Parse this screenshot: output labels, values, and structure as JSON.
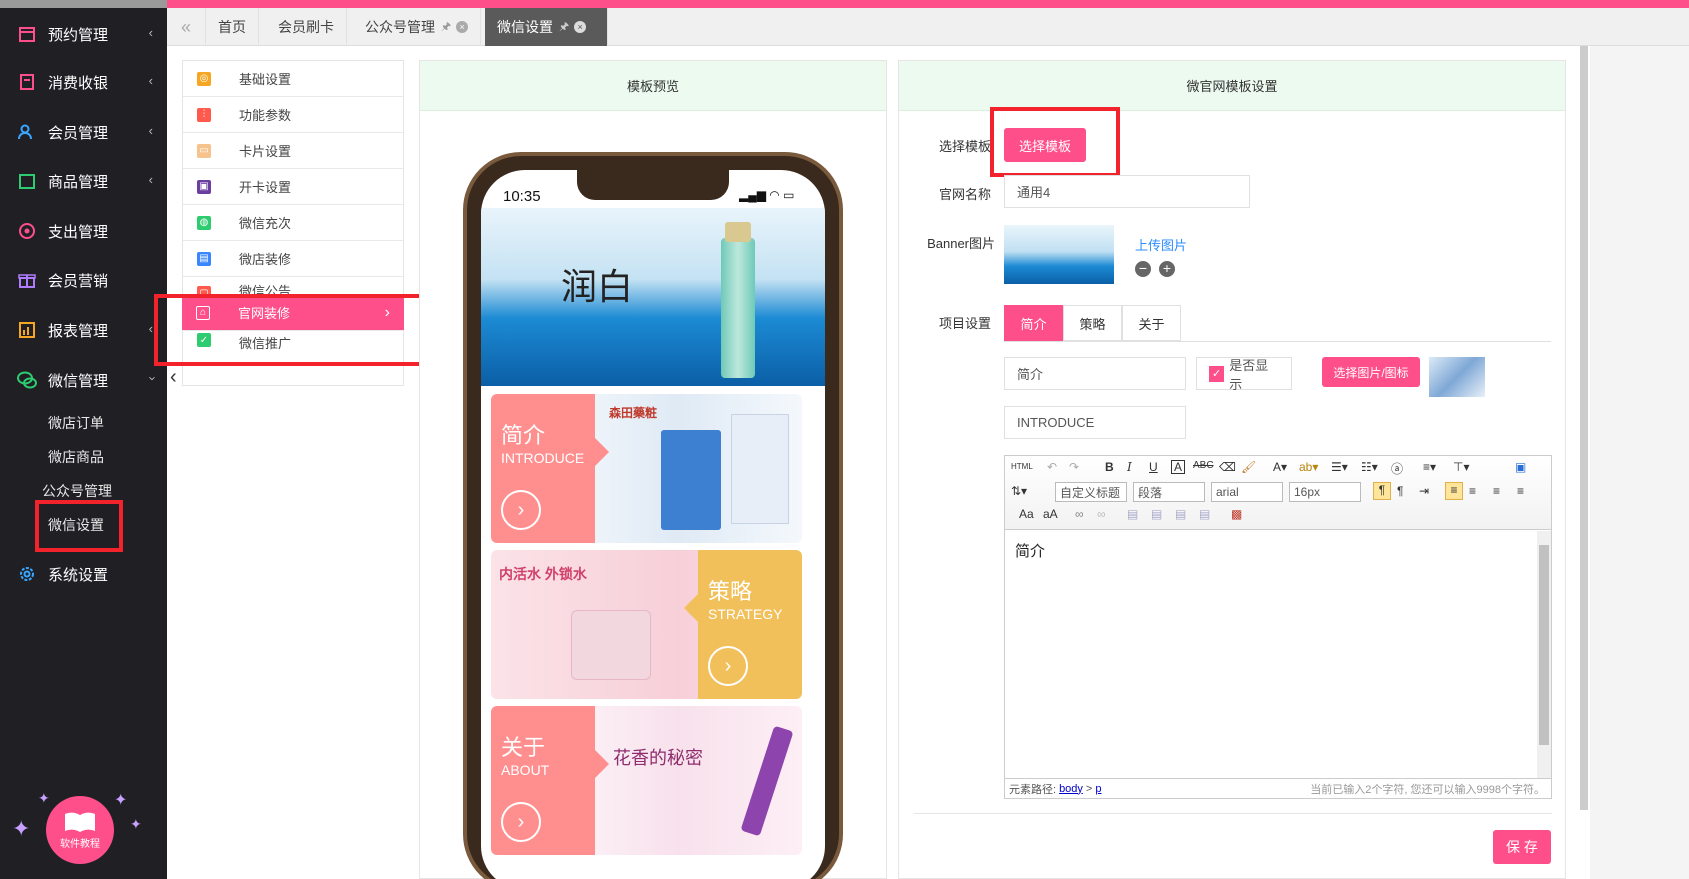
{
  "sidebar": {
    "items": [
      {
        "label": "预约管理",
        "icon": "calendar-icon"
      },
      {
        "label": "消费收银",
        "icon": "cashier-icon"
      },
      {
        "label": "会员管理",
        "icon": "user-icon"
      },
      {
        "label": "商品管理",
        "icon": "goods-icon"
      },
      {
        "label": "支出管理",
        "icon": "expense-icon"
      },
      {
        "label": "会员营销",
        "icon": "gift-icon"
      },
      {
        "label": "报表管理",
        "icon": "report-icon"
      },
      {
        "label": "微信管理",
        "icon": "wechat-icon"
      },
      {
        "label": "系统设置",
        "icon": "gear-icon"
      }
    ],
    "sub_items": [
      "微店订单",
      "微店商品",
      "公众号管理",
      "微信设置"
    ],
    "tutorial_badge": "软件教程"
  },
  "tabs": [
    {
      "label": "首页"
    },
    {
      "label": "会员刷卡"
    },
    {
      "label": "公众号管理"
    },
    {
      "label": "微信设置"
    }
  ],
  "left_menu": {
    "items": [
      "基础设置",
      "功能参数",
      "卡片设置",
      "开卡设置",
      "微信充次",
      "微店装修",
      "微信公告",
      "官网装修",
      "微信推广"
    ]
  },
  "preview_panel": {
    "title": "模板预览",
    "phone_time": "10:35",
    "banner_text": "润白",
    "cards": [
      {
        "title": "简介",
        "subtitle": "INTRODUCE",
        "brand": "森田藥粧"
      },
      {
        "title": "策略",
        "subtitle": "STRATEGY",
        "brand": "内活水 外锁水"
      },
      {
        "title": "关于",
        "subtitle": "ABOUT",
        "brand": "花香的秘密"
      }
    ]
  },
  "settings_panel": {
    "title": "微官网模板设置",
    "template_label": "选择模板",
    "template_button": "选择模板",
    "site_name_label": "官网名称",
    "site_name_value": "通用4",
    "banner_label": "Banner图片",
    "upload_link": "上传图片",
    "project_label": "项目设置",
    "project_tabs": [
      "简介",
      "策略",
      "关于"
    ],
    "item_name_value": "简介",
    "show_checkbox_label": "是否显示",
    "pick_image_button": "选择图片/图标",
    "english_value": "INTRODUCE",
    "save_button": "保 存"
  },
  "editor": {
    "heading_select": "自定义标题",
    "paragraph_select": "段落",
    "font_select": "arial",
    "size_select": "16px",
    "content": "简介",
    "path_label": "元素路径:",
    "path_body": "body",
    "path_sep": ">",
    "path_p": "p",
    "char_count": "当前已输入2个字符, 您还可以输入9998个字符。"
  },
  "colors": {
    "accent": "#ff4f8b",
    "sidebar_bg": "#1f1f24",
    "highlight": "#f2232b",
    "panel_header": "#edfaef"
  }
}
